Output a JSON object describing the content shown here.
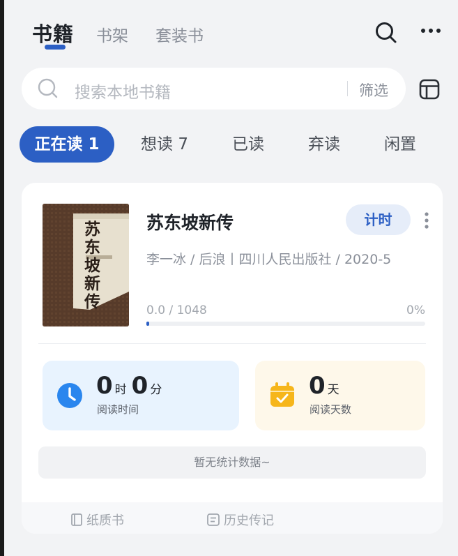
{
  "header": {
    "tabs": [
      {
        "label": "书籍",
        "active": true
      },
      {
        "label": "书架"
      },
      {
        "label": "套装书"
      }
    ],
    "icons": [
      "search-icon",
      "more-icon"
    ]
  },
  "search": {
    "placeholder": "搜索本地书籍",
    "filter_label": "筛选",
    "icon": "search-icon"
  },
  "filters": [
    {
      "label": "正在读 1",
      "active": true
    },
    {
      "label": "想读 7"
    },
    {
      "label": "已读"
    },
    {
      "label": "弃读"
    },
    {
      "label": "闲置"
    }
  ],
  "book": {
    "title": "苏东坡新传",
    "cover_title": "苏东坡新传",
    "meta": "李一冰 / 后浪丨四川人民出版社 / 2020-5",
    "timer_label": "计时",
    "progress_text": "0.0 / 1048",
    "progress_percent_label": "0%",
    "progress_fraction": 0.0
  },
  "stats": {
    "reading_time": {
      "hours": "0",
      "hours_unit": "时",
      "minutes": "0",
      "minutes_unit": "分",
      "label": "阅读时间"
    },
    "reading_days": {
      "days": "0",
      "days_unit": "天",
      "label": "阅读天数"
    }
  },
  "no_data_text": "暂无统计数据~",
  "tags": [
    {
      "label": "纸质书",
      "icon": "book-icon"
    },
    {
      "label": "历史传记",
      "icon": "category-icon"
    }
  ],
  "colors": {
    "accent": "#2c5fc4",
    "time_bg": "#e8f3fe",
    "days_bg": "#fef8ea",
    "clock_icon": "#2a86ee",
    "calendar_icon": "#f6b61b"
  }
}
